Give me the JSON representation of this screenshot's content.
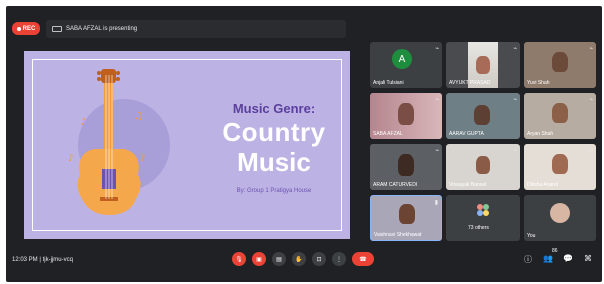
{
  "top": {
    "rec_label": "REC",
    "presenting_text": "SABA AFZAL is presenting"
  },
  "slide": {
    "title_small": "Music Genre:",
    "title_line1": "Country",
    "title_line2": "Music",
    "byline": "By: Group 1 Pratigya House"
  },
  "participants": [
    {
      "name": "Anjali Tulsiani",
      "initial": "A"
    },
    {
      "name": "AVYUKT PRASAD"
    },
    {
      "name": "Yuvi Shah"
    },
    {
      "name": "SABA AFZAL"
    },
    {
      "name": "AARAV GUPTA"
    },
    {
      "name": "Aryan Shah"
    },
    {
      "name": "ARAM CATURVEDI"
    },
    {
      "name": "Vinaayak Bansal"
    },
    {
      "name": "Diksha Anand"
    },
    {
      "name": "Vaishnavi Shekhawat"
    },
    {
      "name": "73 others"
    },
    {
      "name": "You"
    }
  ],
  "bottom": {
    "time_meeting": "12:03 PM  |  tjk-jjmu-vcq",
    "people_badge": "86"
  },
  "colors": {
    "bg": "#202124",
    "red": "#ea4335",
    "slide_bg": "#bcb3e4",
    "slide_purple": "#5b3f9e"
  }
}
